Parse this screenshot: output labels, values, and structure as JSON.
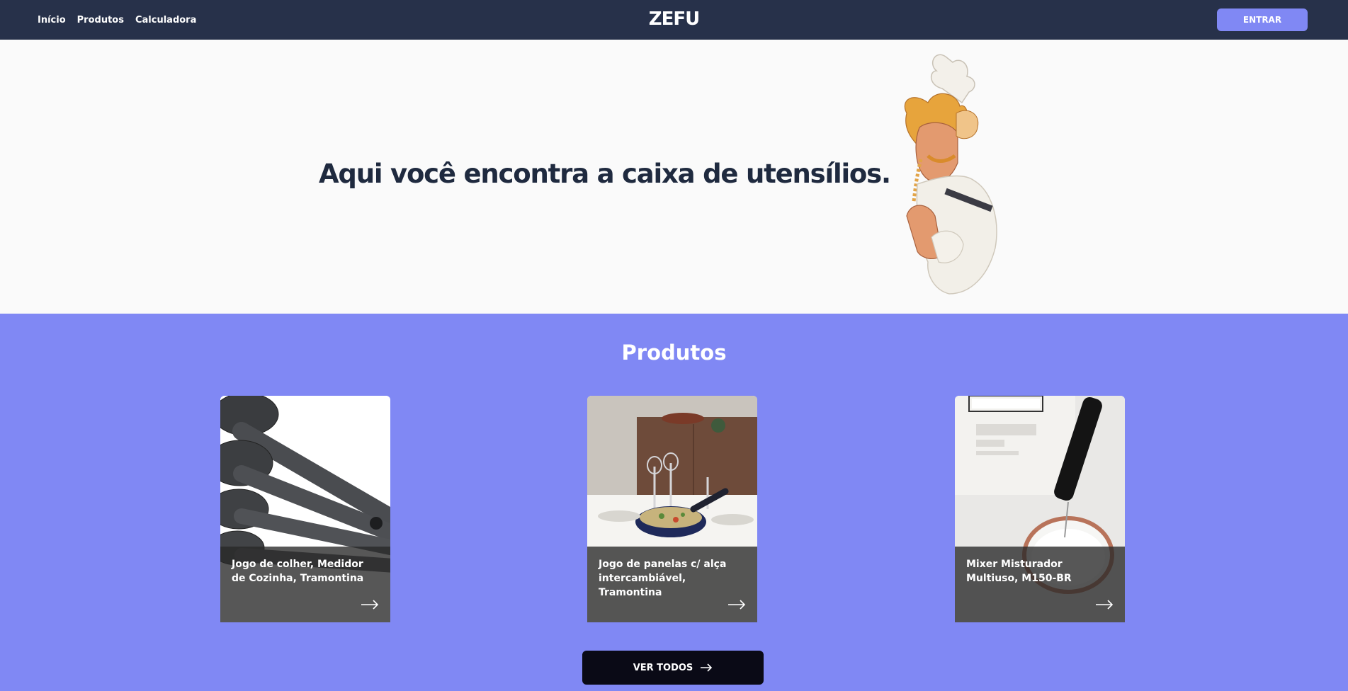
{
  "nav": {
    "links": [
      "Início",
      "Produtos",
      "Calculadora"
    ],
    "logo": "ZEFU",
    "login_label": "ENTRAR"
  },
  "hero": {
    "title": "Aqui você encontra a caixa de utensílios."
  },
  "products": {
    "title": "Produtos",
    "items": [
      {
        "name": "Jogo de colher, Medidor de Cozinha, Tramontina"
      },
      {
        "name": "Jogo de panelas c/ alça intercambiável, Tramontina"
      },
      {
        "name": "Mixer Misturador Multiuso, M150-BR"
      }
    ],
    "view_all_label": "VER TODOS"
  },
  "colors": {
    "navbar": "#27314a",
    "accent": "#8088f4",
    "dark_button": "#0a0a16"
  }
}
